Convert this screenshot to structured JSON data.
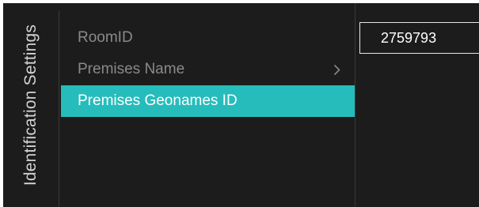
{
  "sidebar": {
    "title": "Identification Settings"
  },
  "menu": {
    "items": [
      {
        "label": "RoomID"
      },
      {
        "label": "Premises Name",
        "icon": "chevron-right-icon"
      },
      {
        "label": "Premises Geonames ID",
        "selected": true
      }
    ]
  },
  "value_panel": {
    "value": "2759793"
  },
  "colors": {
    "background": "#1c1c1c",
    "accent": "#26bcbc",
    "text_dim": "#8a8a8a",
    "text_bright": "#ffffff"
  }
}
